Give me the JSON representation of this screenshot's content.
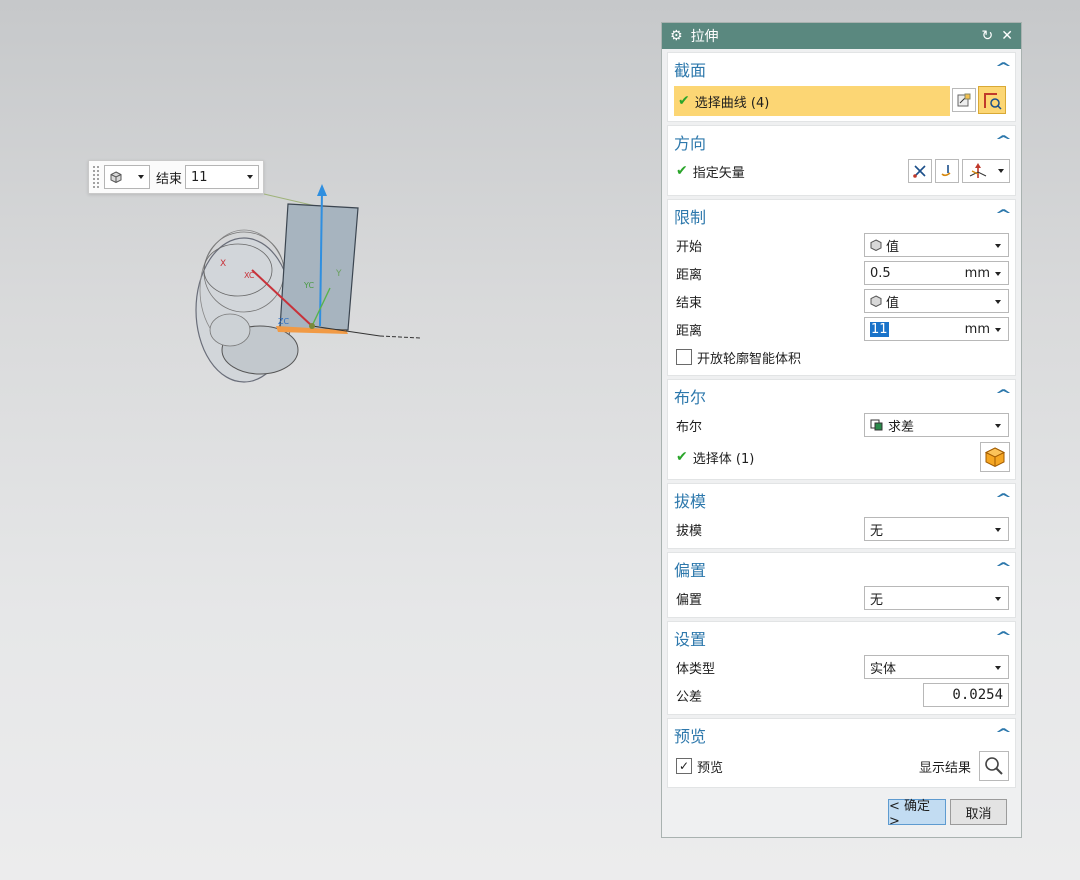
{
  "mini_toolbar": {
    "label": "结束",
    "value": "11"
  },
  "dialog": {
    "title": "拉伸",
    "section": {
      "title": "截面",
      "select_curve": "选择曲线 (4)"
    },
    "direction": {
      "title": "方向",
      "specify_vector": "指定矢量"
    },
    "limits": {
      "title": "限制",
      "start_label": "开始",
      "start_value": "值",
      "distance1_label": "距离",
      "distance1_value": "0.5",
      "distance1_unit": "mm",
      "end_label": "结束",
      "end_value": "值",
      "distance2_label": "距离",
      "distance2_value": "11",
      "distance2_unit": "mm",
      "open_profile": "开放轮廓智能体积"
    },
    "boolean": {
      "title": "布尔",
      "label": "布尔",
      "value": "求差",
      "select_body": "选择体 (1)"
    },
    "draft": {
      "title": "拔模",
      "label": "拔模",
      "value": "无"
    },
    "offset": {
      "title": "偏置",
      "label": "偏置",
      "value": "无"
    },
    "settings": {
      "title": "设置",
      "body_type_label": "体类型",
      "body_type_value": "实体",
      "tolerance_label": "公差",
      "tolerance_value": "0.0254"
    },
    "preview": {
      "title": "预览",
      "checkbox": "预览",
      "show_result": "显示结果"
    },
    "buttons": {
      "ok": "< 确定 >",
      "cancel": "取消"
    }
  },
  "viewport_labels": {
    "xc": "XC",
    "yc": "YC",
    "zc": "ZC",
    "x": "X",
    "y": "Y"
  },
  "colors": {
    "titlebar": "#5a887f",
    "section_title": "#2d78ac",
    "selection": "#fcd674",
    "check": "#2aa52a"
  }
}
